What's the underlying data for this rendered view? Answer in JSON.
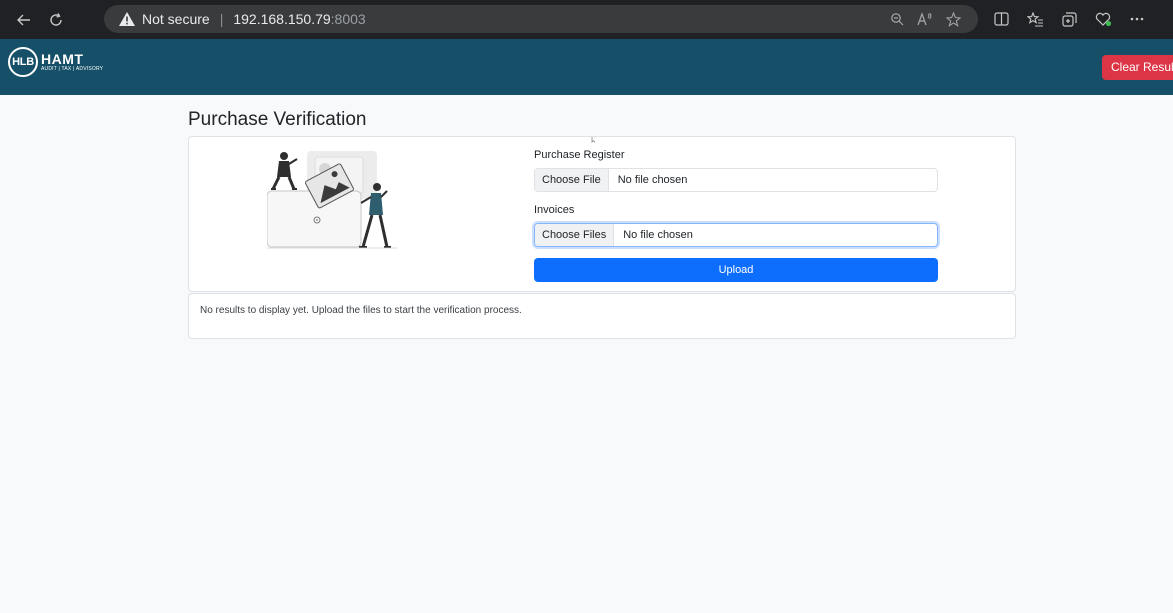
{
  "browser": {
    "security_label": "Not secure",
    "url_host": "192.168.150.79",
    "url_port": ":8003",
    "nav_icons": [
      "back-arrow-icon",
      "refresh-icon"
    ],
    "address_icons": [
      "zoom-icon",
      "read-aloud-icon",
      "favorite-star-icon"
    ],
    "toolbar_icons": [
      "split-screen-icon",
      "favorites-icon",
      "collections-icon",
      "browser-essentials-icon"
    ]
  },
  "header": {
    "logo_mark": "HLB",
    "logo_word": "HAMT",
    "logo_tagline": "AUDIT | TAX | ADVISORY",
    "clear_button_label": "Clear Results",
    "bg_color": "#165068",
    "clear_color": "#dc3545"
  },
  "page": {
    "title": "Purchase Verification"
  },
  "upload_form": {
    "purchase_register": {
      "label": "Purchase Register",
      "button_label": "Choose File",
      "status": "No file chosen"
    },
    "invoices": {
      "label": "Invoices",
      "button_label": "Choose Files",
      "status": "No file chosen"
    },
    "upload_button_label": "Upload",
    "upload_color": "#0d6efd"
  },
  "results": {
    "message": "No results to display yet. Upload the files to start the verification process."
  }
}
